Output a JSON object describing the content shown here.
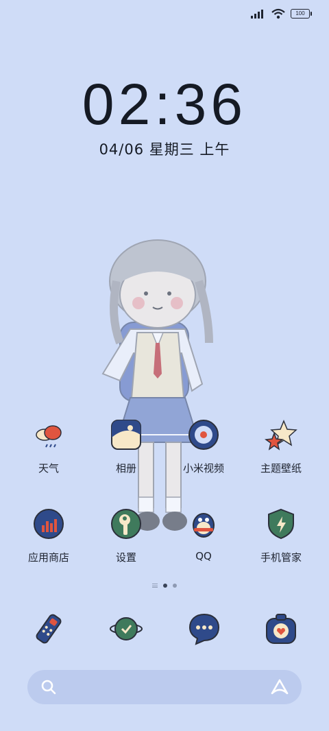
{
  "status_bar": {
    "signal_icon": "signal-icon",
    "wifi_icon": "wifi-icon",
    "battery_level": "100"
  },
  "clock": {
    "time": "02:36",
    "date": "04/06 星期三 上午"
  },
  "apps_row1": [
    {
      "label": "天气",
      "icon": "weather-icon"
    },
    {
      "label": "相册",
      "icon": "gallery-icon"
    },
    {
      "label": "小米视频",
      "icon": "video-icon"
    },
    {
      "label": "主题壁纸",
      "icon": "themes-icon"
    }
  ],
  "apps_row2": [
    {
      "label": "应用商店",
      "icon": "app-store-icon"
    },
    {
      "label": "设置",
      "icon": "settings-icon"
    },
    {
      "label": "QQ",
      "icon": "qq-icon"
    },
    {
      "label": "手机管家",
      "icon": "security-icon"
    }
  ],
  "page_indicator": {
    "pages": 2,
    "current": 1
  },
  "dock": [
    {
      "icon": "phone-icon"
    },
    {
      "icon": "browser-icon"
    },
    {
      "icon": "messages-icon"
    },
    {
      "icon": "camera-icon"
    }
  ],
  "search_bar": {
    "search_icon": "search-icon",
    "assistant_icon": "assistant-icon"
  },
  "colors": {
    "background": "#cfdcf7",
    "icon_navy": "#2f4a8a",
    "icon_green": "#3f7a5c",
    "accent_red": "#e0553f"
  }
}
